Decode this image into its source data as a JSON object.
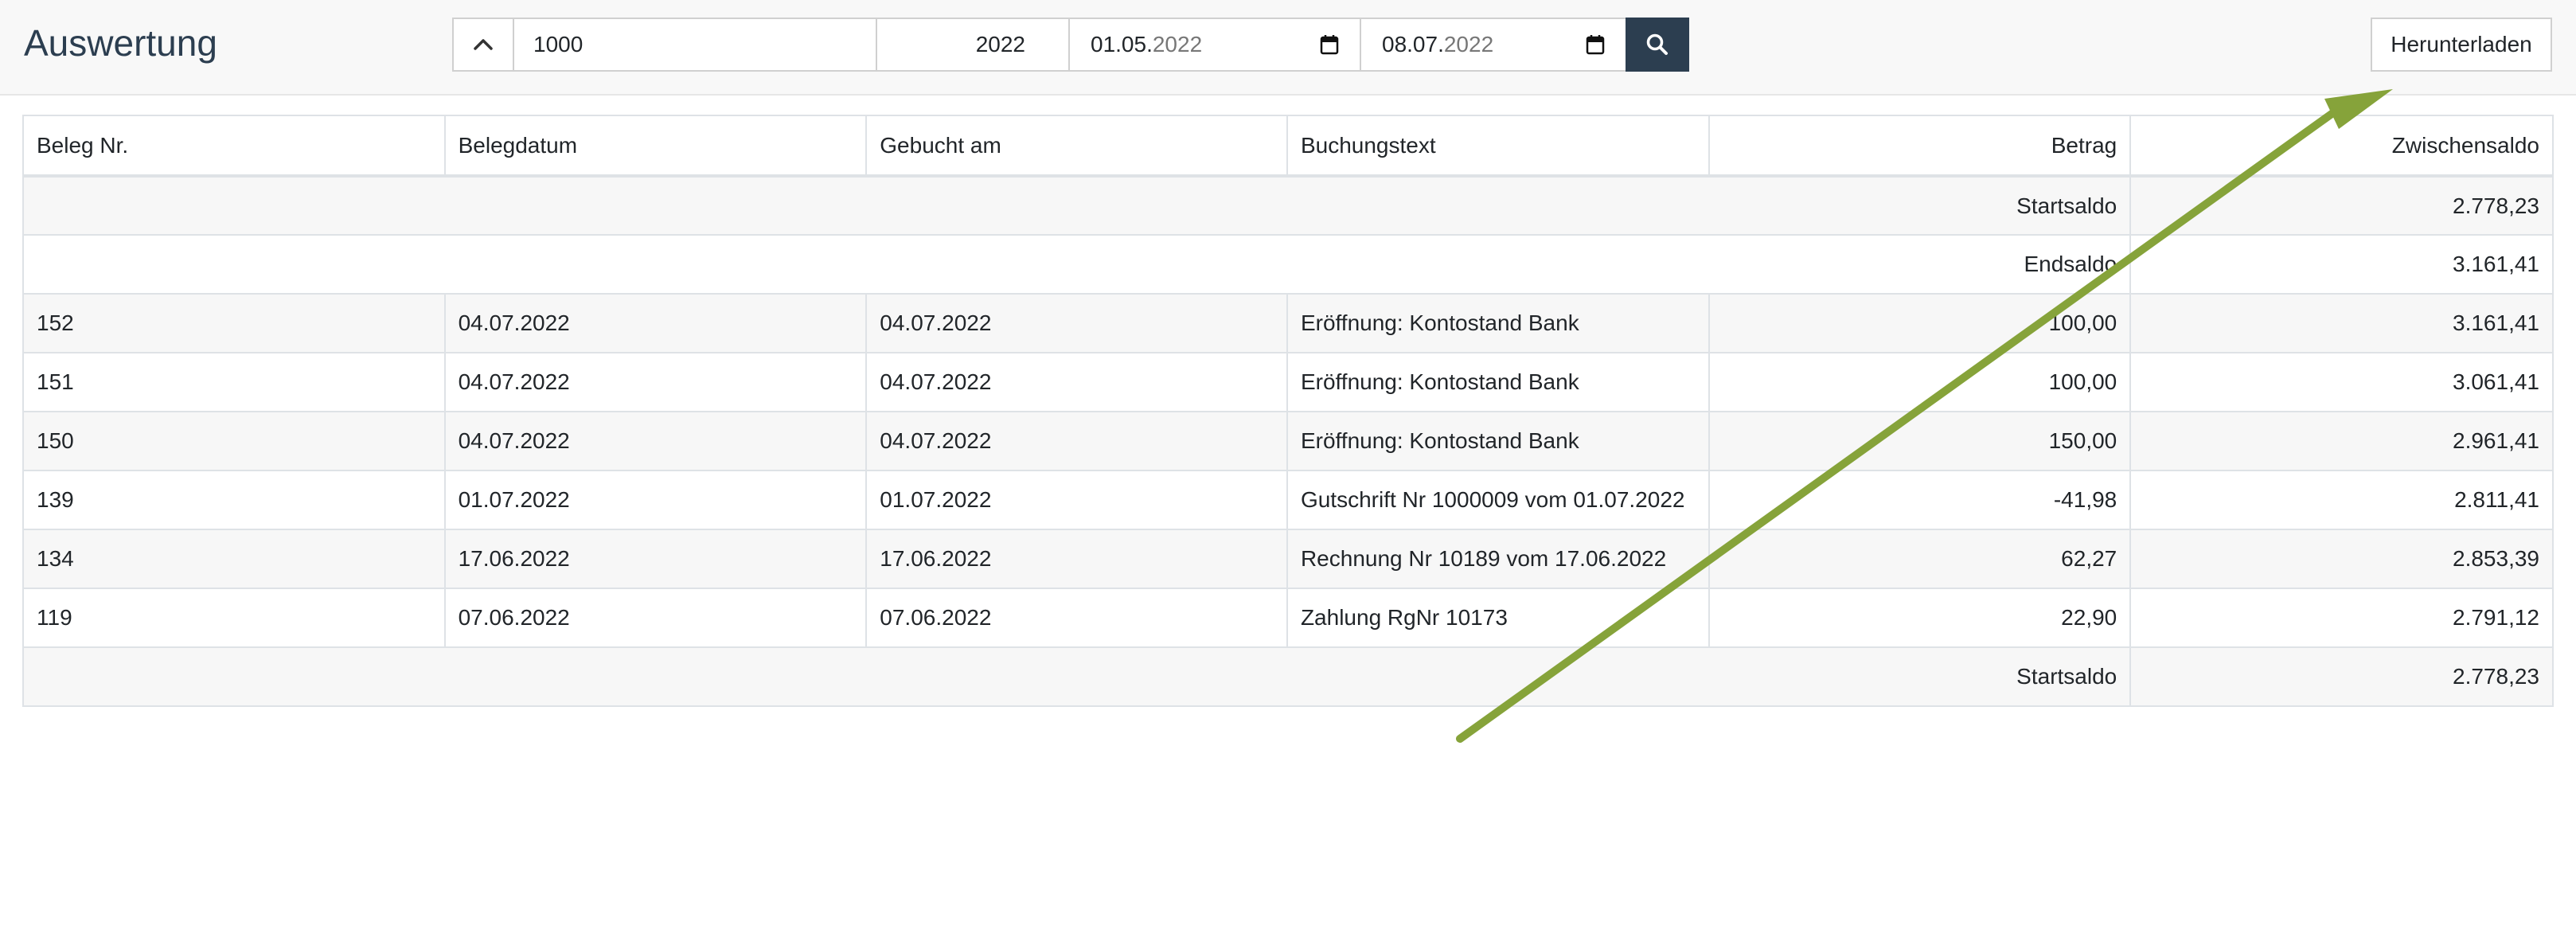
{
  "header": {
    "title": "Auswertung",
    "account_value": "1000",
    "year_value": "2022",
    "date_from": {
      "day_month": "01.05.",
      "year": "2022"
    },
    "date_to": {
      "day_month": "08.07.",
      "year": "2022"
    },
    "download_label": "Herunterladen",
    "icons": {
      "toggle": "chevron-up-icon",
      "calendar": "calendar-icon",
      "search": "search-icon"
    }
  },
  "table": {
    "columns": [
      "Beleg Nr.",
      "Belegdatum",
      "Gebucht am",
      "Buchungstext",
      "Betrag",
      "Zwischensaldo"
    ],
    "summary_top": [
      {
        "label": "Startsaldo",
        "value": "2.778,23"
      },
      {
        "label": "Endsaldo",
        "value": "3.161,41"
      }
    ],
    "rows": [
      {
        "beleg": "152",
        "belegdatum": "04.07.2022",
        "gebucht": "04.07.2022",
        "text": "Eröffnung: Kontostand Bank",
        "betrag": "100,00",
        "saldo": "3.161,41"
      },
      {
        "beleg": "151",
        "belegdatum": "04.07.2022",
        "gebucht": "04.07.2022",
        "text": "Eröffnung: Kontostand Bank",
        "betrag": "100,00",
        "saldo": "3.061,41"
      },
      {
        "beleg": "150",
        "belegdatum": "04.07.2022",
        "gebucht": "04.07.2022",
        "text": "Eröffnung: Kontostand Bank",
        "betrag": "150,00",
        "saldo": "2.961,41"
      },
      {
        "beleg": "139",
        "belegdatum": "01.07.2022",
        "gebucht": "01.07.2022",
        "text": "Gutschrift Nr 1000009 vom 01.07.2022",
        "betrag": "-41,98",
        "saldo": "2.811,41"
      },
      {
        "beleg": "134",
        "belegdatum": "17.06.2022",
        "gebucht": "17.06.2022",
        "text": "Rechnung Nr 10189 vom 17.06.2022",
        "betrag": "62,27",
        "saldo": "2.853,39"
      },
      {
        "beleg": "119",
        "belegdatum": "07.06.2022",
        "gebucht": "07.06.2022",
        "text": "Zahlung RgNr 10173",
        "betrag": "22,90",
        "saldo": "2.791,12"
      }
    ],
    "summary_bottom": {
      "label": "Startsaldo",
      "value": "2.778,23"
    }
  },
  "colors": {
    "accent": "#2c3e50",
    "annotation_arrow": "#86a33a"
  }
}
